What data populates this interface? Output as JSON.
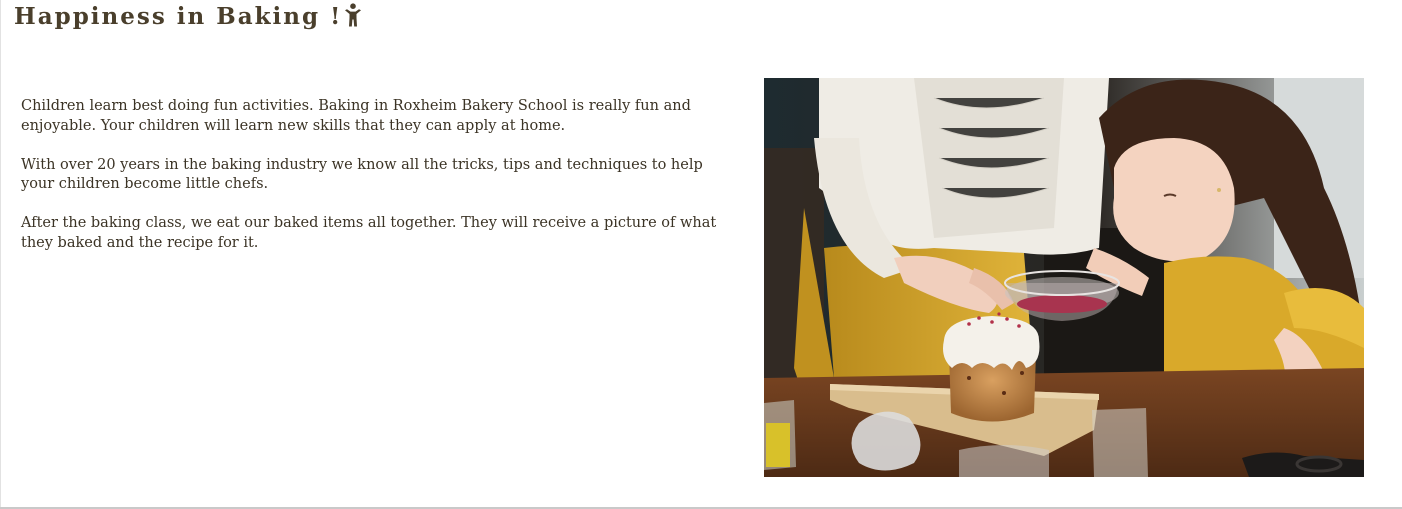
{
  "page": {
    "title": "Happiness in Baking !",
    "title_icon": "child-icon"
  },
  "content": {
    "paragraphs": [
      "Children learn best doing fun activities. Baking in Roxheim Bakery School is really fun and enjoyable. Your children will learn new skills that they can apply at home.",
      "With over 20 years in the baking industry we know all the tricks, tips and techniques to help your children become little chefs.",
      "After the baking class, we eat our baked items all together. They will receive a picture of what they baked and the recipe for it."
    ]
  },
  "colors": {
    "text": "#3b3325",
    "title": "#4a3f2c",
    "apron_yellow": "#d9a92a",
    "table_wood": "#6b3e1f"
  }
}
